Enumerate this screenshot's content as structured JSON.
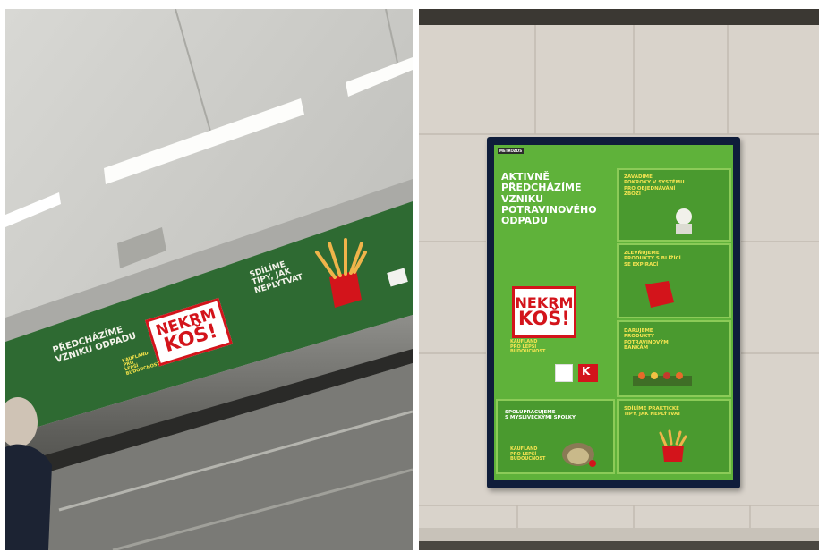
{
  "photos": [
    {
      "id": "escalator",
      "banner": {
        "left_text": "PŘEDCHÁZÍME\nVZNIKU ODPADU",
        "logo_line1": "NEKRM",
        "logo_line2": "KOŠ!",
        "tagline": "KAUFLAND\npro\nLEPŠÍ\nBUDOUCNOST",
        "right_text": "SDÍLÍME\nTIPY, JAK\nNEPLÝTVAT",
        "colors": {
          "banner_green": "#2e6a32",
          "logo_red": "#d3141b",
          "tag_yellow": "#f5e34a"
        }
      }
    },
    {
      "id": "wall-poster",
      "poster": {
        "corner_label": "METROADS",
        "headline": "AKTIVNĚ\nPŘEDCHÁZÍME\nVZNIKU\nPOTRAVINOVÉHO\nODPADU",
        "logo_line1": "NEKRM",
        "logo_line2": "KOŠ!",
        "tagline": "KAUFLAND\npro LEPŠÍ\nBUDOUCNOST",
        "cells": [
          {
            "title": "ZAVÁDÍME\nPOKROKY V SYSTÉMU\nPRO OBJEDNÁVÁNÍ\nZBOŽÍ"
          },
          {
            "title": "ZLEVŇUJEME\nPRODUKTY S BLÍŽÍCÍ\nSE EXPIRACÍ"
          },
          {
            "title": "DARUJEME\nPRODUKTY\nPOTRAVINOVÝM\nBANKÁM"
          },
          {
            "title": "SDÍLÍME PRAKTICKÉ\nTIPY, JAK NEPLÝTVAT"
          }
        ],
        "bottom_left_title": "SPOLUPRACUJEME\nS MYSLIVECKÝMI SPOLKY",
        "colors": {
          "poster_green": "#5fb23a",
          "frame_navy": "#0f1d3b"
        }
      }
    }
  ]
}
